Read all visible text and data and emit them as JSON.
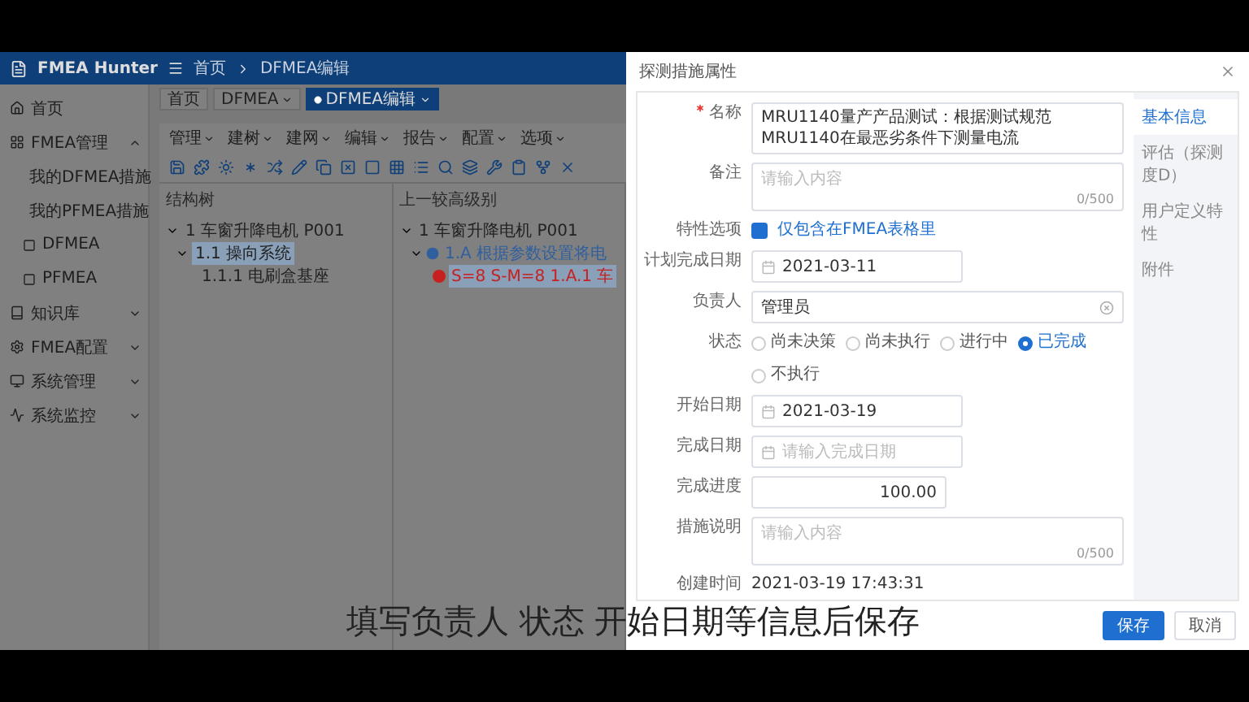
{
  "app": {
    "logo": "FMEA Hunter",
    "breadcrumb": [
      "首页",
      "DFMEA编辑"
    ],
    "tabs": [
      {
        "label": "首页",
        "selected": false,
        "dropdown": false
      },
      {
        "label": "DFMEA",
        "selected": false,
        "dropdown": true
      },
      {
        "label": "DFMEA编辑",
        "selected": true,
        "dropdown": true
      }
    ],
    "sidebar": {
      "items": [
        {
          "label": "首页",
          "kind": "link"
        },
        {
          "label": "FMEA管理",
          "kind": "group",
          "expanded": true,
          "children": [
            {
              "label": "我的DFMEA措施"
            },
            {
              "label": "我的PFMEA措施"
            },
            {
              "label": "DFMEA"
            },
            {
              "label": "PFMEA"
            }
          ]
        },
        {
          "label": "知识库",
          "kind": "group",
          "expanded": false
        },
        {
          "label": "FMEA配置",
          "kind": "group",
          "expanded": false
        },
        {
          "label": "系统管理",
          "kind": "group",
          "expanded": false
        },
        {
          "label": "系统监控",
          "kind": "group",
          "expanded": false
        }
      ]
    },
    "menu": [
      "管理",
      "建树",
      "建网",
      "编辑",
      "报告",
      "配置",
      "选项"
    ],
    "panels": [
      {
        "title": "结构树",
        "tree": [
          {
            "label": "1 车窗升降电机 P001",
            "selected": false,
            "children": [
              {
                "label": "1.1 操向系统",
                "selected": true,
                "children": [
                  {
                    "label": "1.1.1 电刷盒基座",
                    "selected": false
                  }
                ]
              }
            ]
          }
        ]
      },
      {
        "title": "上一较高级别",
        "tree": [
          {
            "label": "1 车窗升降电机 P001",
            "selected": false,
            "children": [
              {
                "label": "1.A 根据参数设置将电",
                "kind": "function",
                "selected": false,
                "color": "#2f5f9e",
                "children": [
                  {
                    "label": "S=8 S-M=8 1.A.1 车",
                    "kind": "failure",
                    "selected": true,
                    "color": "#c62020"
                  }
                ]
              }
            ]
          }
        ]
      }
    ]
  },
  "dialog": {
    "title": "探测措施属性",
    "fields": [
      {
        "kind": "text",
        "label": "名称",
        "required": true,
        "value": "MRU1140量产产品测试：根据测试规范MRU1140在最恶劣条件下测量电流"
      },
      {
        "kind": "textarea",
        "label": "备注",
        "required": false,
        "placeholder": "请输入内容",
        "counter": "0/500"
      },
      {
        "kind": "checkbox",
        "label": "特性选项",
        "required": false,
        "option": "仅包含在FMEA表格里",
        "checked": true
      },
      {
        "kind": "date",
        "label": "计划完成日期",
        "required": false,
        "value": "2021-03-11"
      },
      {
        "kind": "select",
        "label": "负责人",
        "required": false,
        "value": "管理员"
      },
      {
        "kind": "radio",
        "label": "状态",
        "required": false,
        "options": [
          {
            "label": "尚未决策",
            "selected": false
          },
          {
            "label": "尚未执行",
            "selected": false
          },
          {
            "label": "进行中",
            "selected": false
          },
          {
            "label": "已完成",
            "selected": true
          },
          {
            "label": "不执行",
            "selected": false
          }
        ]
      },
      {
        "kind": "date",
        "label": "开始日期",
        "required": false,
        "value": "2021-03-19"
      },
      {
        "kind": "date",
        "label": "完成日期",
        "required": false,
        "placeholder": "请输入完成日期"
      },
      {
        "kind": "number",
        "label": "完成进度",
        "required": false,
        "value": "100.00"
      },
      {
        "kind": "textarea",
        "label": "措施说明",
        "required": false,
        "placeholder": "请输入内容",
        "counter": "0/500"
      },
      {
        "kind": "static",
        "label": "创建时间",
        "required": false,
        "value": "2021-03-19 17:43:31"
      }
    ],
    "side_tabs": [
      {
        "label": "基本信息",
        "selected": true
      },
      {
        "label": "评估（探测度D）",
        "selected": false
      },
      {
        "label": "用户定义特性",
        "selected": false
      },
      {
        "label": "附件",
        "selected": false
      }
    ],
    "buttons": [
      {
        "label": "保存",
        "kind": "primary"
      },
      {
        "label": "取消",
        "kind": "plain"
      }
    ]
  },
  "caption": "填写负责人 状态 开始日期等信息后保存"
}
